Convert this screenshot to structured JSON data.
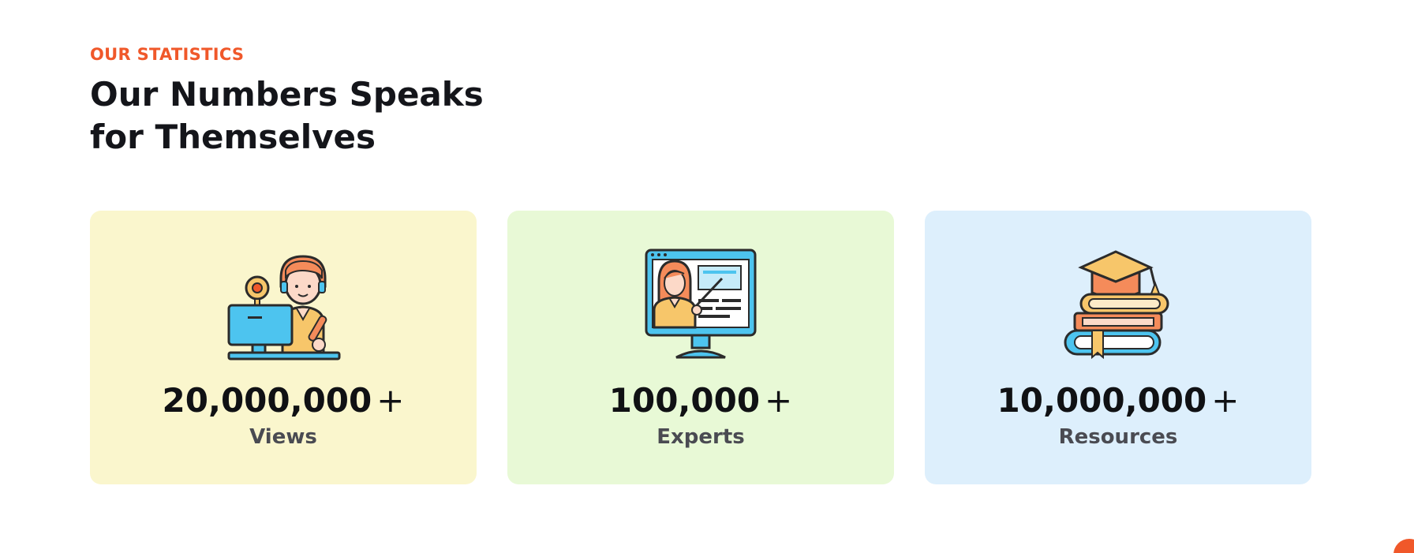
{
  "section": {
    "eyebrow": "OUR STATISTICS",
    "heading": "Our Numbers Speaks for Themselves"
  },
  "stats": [
    {
      "value": "20,000,000",
      "suffix": "+",
      "label": "Views",
      "icon": "online-teacher-icon",
      "background": "#faf6cd"
    },
    {
      "value": "100,000",
      "suffix": "+",
      "label": "Experts",
      "icon": "online-presentation-icon",
      "background": "#e8f9d6"
    },
    {
      "value": "10,000,000",
      "suffix": "+",
      "label": "Resources",
      "icon": "books-graduation-cap-icon",
      "background": "#ddeffc"
    }
  ],
  "colors": {
    "accent": "#f0582a",
    "heading": "#14151a",
    "label": "#4a4b52"
  }
}
